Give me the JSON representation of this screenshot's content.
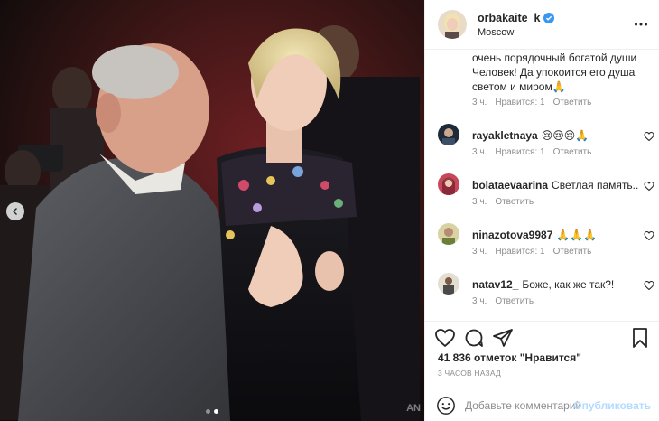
{
  "header": {
    "username": "orbakaite_k",
    "location": "Moscow",
    "verified_icon": "verified-badge-icon",
    "more_icon": "more-options-icon"
  },
  "caption": {
    "text": "очень порядочный богатой души Человек! Да упокоится его душа светом и миром🙏",
    "time": "3 ч.",
    "likes": "Нравится: 1",
    "reply": "Ответить"
  },
  "comments": [
    {
      "user": "rayakletnaya",
      "text": "😢😢😢🙏",
      "time": "3 ч.",
      "likes": "Нравится: 1",
      "reply": "Ответить"
    },
    {
      "user": "bolataevaarina",
      "text": "Светлая память..",
      "time": "3 ч.",
      "likes": "",
      "reply": "Ответить"
    },
    {
      "user": "ninazotova9987",
      "text": "🙏🙏🙏",
      "time": "3 ч.",
      "likes": "Нравится: 1",
      "reply": "Ответить"
    },
    {
      "user": "natav12_",
      "text": "Боже, как же так?!",
      "time": "3 ч.",
      "likes": "",
      "reply": "Ответить"
    }
  ],
  "actions": {
    "likes_count": "41 836 отметок \"Нравится\"",
    "date": "3 ЧАСОВ НАЗАД",
    "comment_placeholder": "Добавьте комментарий...",
    "post_label": "Опубликовать"
  },
  "photo": {
    "watermark": "AN",
    "slide_count": 2,
    "active_slide": 2
  },
  "colors": {
    "link_disabled": "#b3dbff",
    "secondary_text": "#8e8e8e",
    "border": "#efefef",
    "verified": "#3897f0"
  }
}
